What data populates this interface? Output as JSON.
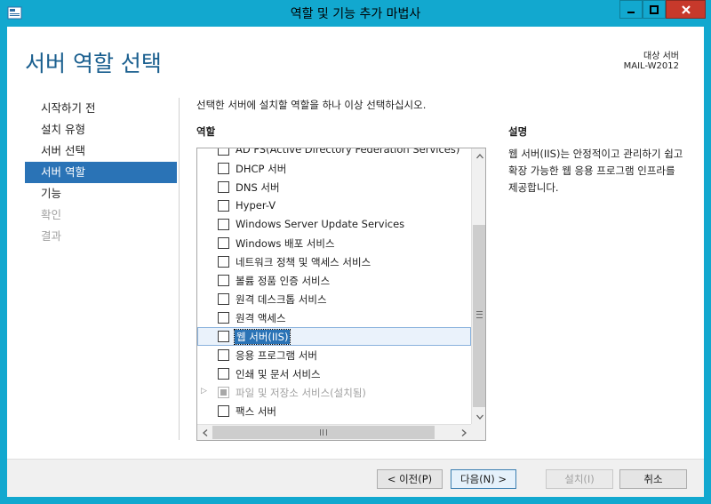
{
  "window": {
    "title": "역할 및 기능 추가 마법사"
  },
  "header": {
    "page_title": "서버 역할 선택",
    "destination_label": "대상 서버",
    "destination_value": "MAIL-W2012"
  },
  "nav": {
    "items": [
      {
        "label": "시작하기 전",
        "state": "normal"
      },
      {
        "label": "설치 유형",
        "state": "normal"
      },
      {
        "label": "서버 선택",
        "state": "normal"
      },
      {
        "label": "서버 역할",
        "state": "active"
      },
      {
        "label": "기능",
        "state": "normal"
      },
      {
        "label": "확인",
        "state": "disabled"
      },
      {
        "label": "결과",
        "state": "disabled"
      }
    ]
  },
  "main": {
    "instruction": "선택한 서버에 설치할 역할을 하나 이상 선택하십시오.",
    "roles_header": "역할",
    "roles": [
      {
        "label": "AD FS(Active Directory Federation Services)",
        "checked": false
      },
      {
        "label": "DHCP 서버",
        "checked": false
      },
      {
        "label": "DNS 서버",
        "checked": false
      },
      {
        "label": "Hyper-V",
        "checked": false
      },
      {
        "label": "Windows Server Update Services",
        "checked": false
      },
      {
        "label": "Windows 배포 서비스",
        "checked": false
      },
      {
        "label": "네트워크 정책 및 액세스 서비스",
        "checked": false
      },
      {
        "label": "볼륨 정품 인증 서비스",
        "checked": false
      },
      {
        "label": "원격 데스크톱 서비스",
        "checked": false
      },
      {
        "label": "원격 액세스",
        "checked": false
      },
      {
        "label": "웹 서버(IIS)",
        "checked": false,
        "selected": true
      },
      {
        "label": "응용 프로그램 서버",
        "checked": false
      },
      {
        "label": "인쇄 및 문서 서비스",
        "checked": false
      },
      {
        "label": "파일 및 저장소 서비스(설치됨)",
        "checked": "partial",
        "expandable": true,
        "installed": true
      },
      {
        "label": "팩스 서버",
        "checked": false
      }
    ],
    "description_header": "설명",
    "description_text": "웹 서버(IIS)는 안정적이고 관리하기 쉽고 확장 가능한 웹 응용 프로그램 인프라를 제공합니다."
  },
  "footer": {
    "prev_label": "< 이전(P)",
    "next_label": "다음(N) >",
    "install_label": "설치(I)",
    "cancel_label": "취소"
  },
  "colors": {
    "window_frame": "#12a8cf",
    "close_button": "#c7392b",
    "title_accent": "#1a5f8f",
    "nav_active": "#2a73b6"
  }
}
